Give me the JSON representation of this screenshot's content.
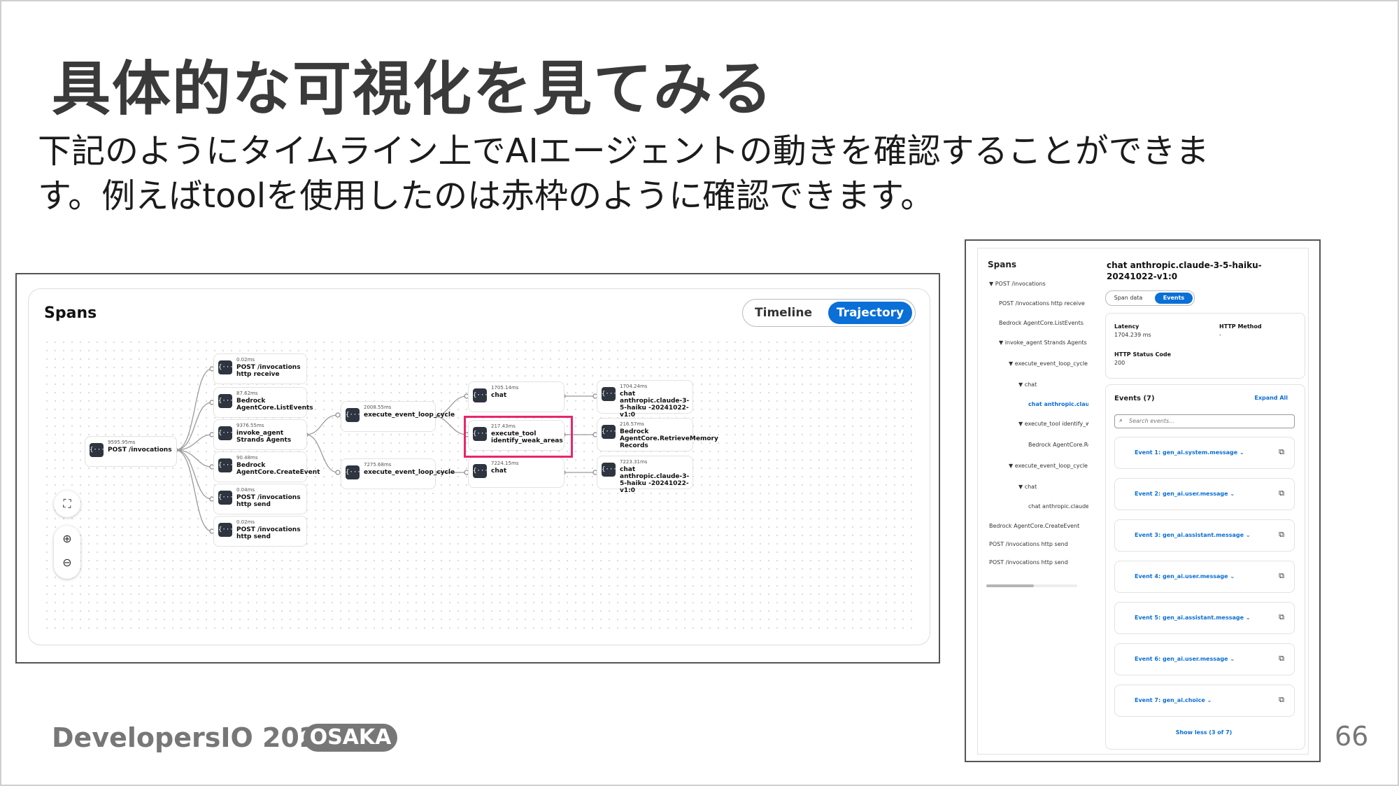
{
  "slide": {
    "title": "具体的な可視化を見てみる",
    "body_line1": "下記のようにタイムライン上でAIエージェントの動きを確認することができま",
    "body_line2": "す。例えばtoolを使用したのは赤枠のように確認できます。",
    "footer_brand": "DevelopersIO 2025",
    "footer_badge": "OSAKA",
    "page_number": "66",
    "highlight_color": "#e8276b",
    "accent_color": "#0a6fd6"
  },
  "spans_panel": {
    "title": "Spans",
    "toggle": {
      "timeline_label": "Timeline",
      "trajectory_label": "Trajectory",
      "selected": "Trajectory"
    },
    "icon_glyph": "{···}",
    "nodes": [
      {
        "dur": "9595.95ms",
        "label": "POST /invocations"
      },
      {
        "dur": "0.02ms",
        "label": "POST /invocations http receive"
      },
      {
        "dur": "87.62ms",
        "label": "Bedrock AgentCore.ListEvents"
      },
      {
        "dur": "9376.55ms",
        "label": "invoke_agent Strands Agents"
      },
      {
        "dur": "90.48ms",
        "label": "Bedrock AgentCore.CreateEvent"
      },
      {
        "dur": "0.04ms",
        "label": "POST /invocations http send"
      },
      {
        "dur": "0.02ms",
        "label": "POST /invocations http send"
      },
      {
        "dur": "2008.55ms",
        "label": "execute_event_loop_cycle"
      },
      {
        "dur": "7275.68ms",
        "label": "execute_event_loop_cycle"
      },
      {
        "dur": "1705.14ms",
        "label": "chat"
      },
      {
        "dur": "217.43ms",
        "label": "execute_tool identify_weak_areas"
      },
      {
        "dur": "7224.15ms",
        "label": "chat"
      },
      {
        "dur": "1704.24ms",
        "label": "chat anthropic.claude-3-5-haiku -20241022-v1:0"
      },
      {
        "dur": "216.57ms",
        "label": "Bedrock AgentCore.RetrieveMemory Records"
      },
      {
        "dur": "7223.31ms",
        "label": "chat anthropic.claude-3-5-haiku -20241022-v1:0"
      }
    ],
    "controls": {
      "fit": "⛶",
      "zoom_in": "⊕",
      "zoom_out": "⊖"
    }
  },
  "detail_panel": {
    "tree_title": "Spans",
    "tree_items": [
      "▼  POST /invocations",
      "POST /invocations http receive",
      "Bedrock AgentCore.ListEvents",
      "▼  invoke_agent Strands Agents",
      "▼  execute_event_loop_cycle",
      "▼  chat",
      "chat anthropic.claude-3-5-haiku",
      "▼  execute_tool identify_weak_areas",
      "Bedrock AgentCore.RetrieveMemory",
      "▼  execute_event_loop_cycle",
      "▼  chat",
      "chat anthropic.claude-3-5-haiku",
      "Bedrock AgentCore.CreateEvent",
      "POST /invocations http send",
      "POST /invocations http send"
    ],
    "tree_active_index": 6,
    "title": "chat anthropic.claude-3-5-haiku-20241022-v1:0",
    "tabs": {
      "span_data": "Span data",
      "events": "Events"
    },
    "latency_label": "Latency",
    "latency_value": "1704.239 ms",
    "http_method_label": "HTTP Method",
    "http_method_value": "-",
    "http_status_label": "HTTP Status Code",
    "http_status_value": "200",
    "events_title": "Events (7)",
    "expand_all": "Expand All",
    "search_placeholder": "Search events...",
    "events": [
      "Event 1: gen_ai.system.message  ⌄",
      "Event 2: gen_ai.user.message  ⌄",
      "Event 3: gen_ai.assistant.message  ⌄",
      "Event 4: gen_ai.user.message  ⌄",
      "Event 5: gen_ai.assistant.message  ⌄",
      "Event 6: gen_ai.user.message  ⌄",
      "Event 7: gen_ai.choice  ⌄"
    ],
    "copy_glyph": "⧉",
    "show_less": "Show less (3 of 7)"
  }
}
